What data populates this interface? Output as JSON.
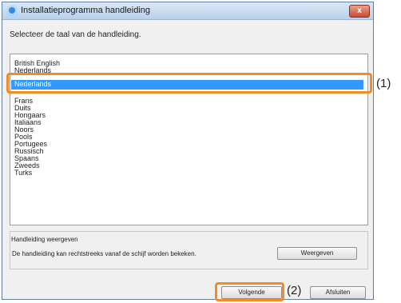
{
  "window": {
    "title": "Installatieprogramma handleiding",
    "close_label": "x"
  },
  "instruction": "Selecteer de taal van de handleiding.",
  "languages": [
    "British English",
    "Nederlands",
    "Frans",
    "Duits",
    "Hongaars",
    "Italiaans",
    "Noors",
    "Pools",
    "Portugees",
    "Russisch",
    "Spaans",
    "Zweeds",
    "Turks"
  ],
  "language_extras": [
    "Nederlands"
  ],
  "selected_language": "Nederlands",
  "view_group": {
    "title": "Handleiding weergeven",
    "description": "De handleiding kan rechtstreeks vanaf de schijf worden bekeken.",
    "view_button": "Weergeven"
  },
  "buttons": {
    "next": "Volgende",
    "exit": "Afsluiten"
  },
  "callouts": {
    "one": "(1)",
    "two": "(2)"
  },
  "colors": {
    "selection": "#3399ff",
    "callout": "#f28c28"
  }
}
